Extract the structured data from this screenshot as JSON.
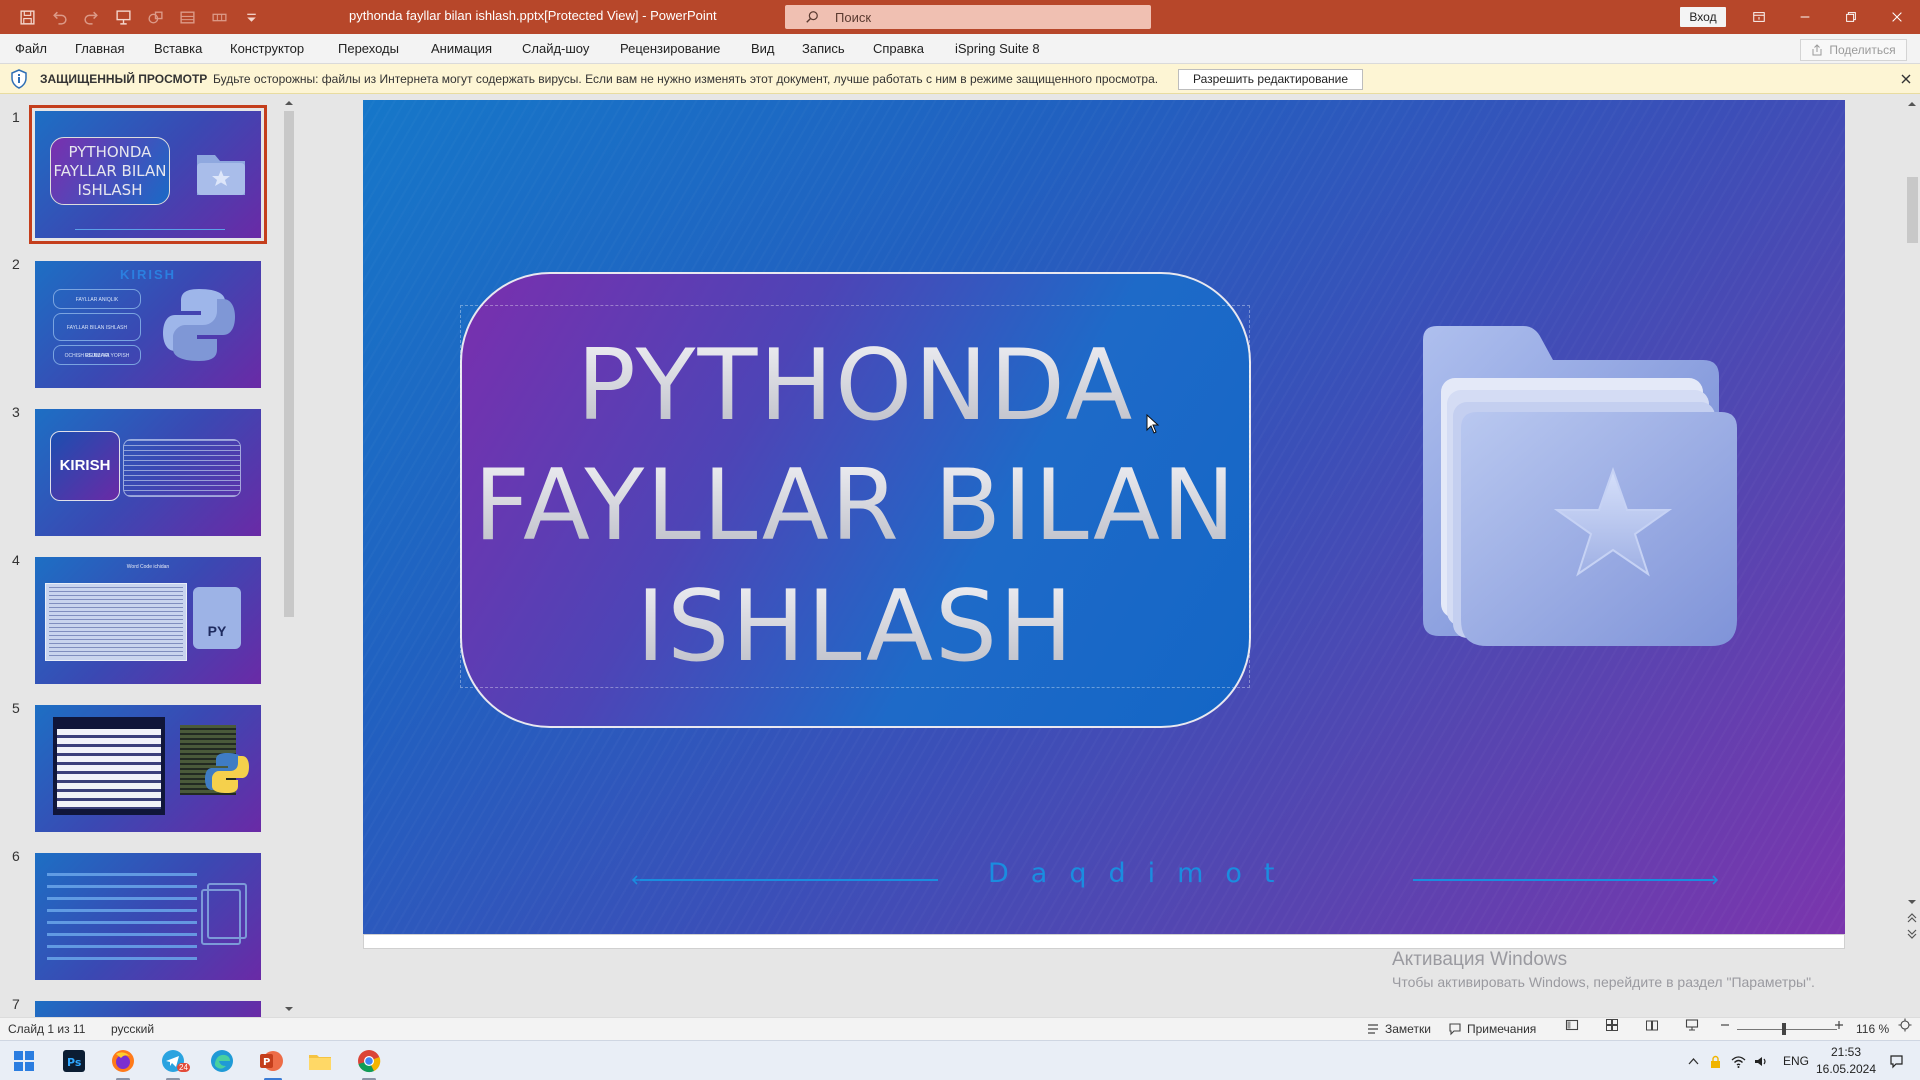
{
  "window": {
    "title": "pythonda fayllar bilan ishlash.pptx[Protected View]  -  PowerPoint",
    "search_placeholder": "Поиск",
    "login_label": "Вход"
  },
  "ribbon": {
    "tabs": [
      "Файл",
      "Главная",
      "Вставка",
      "Конструктор",
      "Переходы",
      "Анимация",
      "Слайд-шоу",
      "Рецензирование",
      "Вид",
      "Запись",
      "Справка",
      "iSpring Suite 8"
    ],
    "share_label": "Поделиться"
  },
  "protected_view": {
    "title": "ЗАЩИЩЕННЫЙ ПРОСМОТР",
    "message": "Будьте осторожны: файлы из Интернета могут содержать вирусы. Если вам не нужно изменять этот документ, лучше работать с ним в режиме защищенного просмотра.",
    "enable_button": "Разрешить редактирование"
  },
  "thumbnails": {
    "numbers": [
      "1",
      "2",
      "3",
      "4",
      "5",
      "6",
      "7"
    ],
    "slide1": {
      "line1": "PYTHONDA",
      "line2": "FAYLLAR BILAN",
      "line3": "ISHLASH"
    },
    "slide2": {
      "heading": "KIRISH",
      "items": [
        "FAYLLAR ANIQLIK",
        "FAYLLAR BILAN ISHLASH USULLARI",
        "OCHISH REJIMI VA YOPISH"
      ]
    },
    "slide3": {
      "heading": "KIRISH"
    },
    "slide4": {
      "heading": "Word Code ichidan",
      "badge": "PY"
    }
  },
  "slide": {
    "title_lines": [
      "PYTHONDA",
      "FAYLLAR BILAN",
      "ISHLASH"
    ],
    "footer_text": "Daqdimot"
  },
  "watermark": {
    "line1": "Активация Windows",
    "line2": "Чтобы активировать Windows, перейдите в раздел \"Параметры\"."
  },
  "statusbar": {
    "slide_info": "Слайд 1 из 11",
    "language": "русский",
    "notes": "Заметки",
    "comments": "Примечания",
    "zoom": "116 %"
  },
  "taskbar": {
    "apps": [
      "start-icon",
      "photoshop-icon",
      "firefox-icon",
      "telegram-icon",
      "edge-icon",
      "powerpoint-icon",
      "file-explorer-icon",
      "chrome-icon"
    ],
    "telegram_badge": "24",
    "lang": "ENG",
    "time": "21:53",
    "date": "16.05.2024"
  },
  "colors": {
    "title_bar": "#b7472a",
    "accent_selection": "#c43e1c",
    "slide_gradient_start": "#1677c9",
    "slide_gradient_end": "#7b35ad",
    "footer_text": "#1a8de0"
  }
}
